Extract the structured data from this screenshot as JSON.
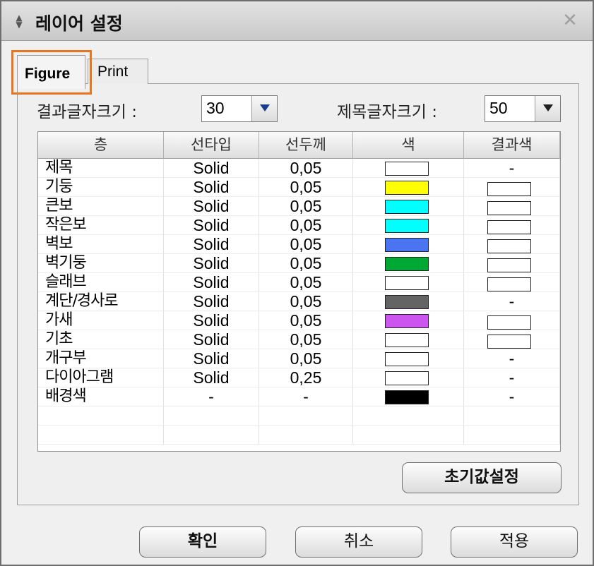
{
  "window": {
    "title": "레이어 설정",
    "title_icon": "updown-arrows-icon",
    "close_icon": "close-icon"
  },
  "tabs": [
    {
      "label": "Figure",
      "selected": true
    },
    {
      "label": "Print",
      "selected": false
    }
  ],
  "settings": {
    "result_font_size_label": "결과글자크기 :",
    "result_font_size_value": "30",
    "title_font_size_label": "제목글자크기 :",
    "title_font_size_value": "50"
  },
  "table": {
    "columns": [
      "층",
      "선타입",
      "선두께",
      "색",
      "결과색"
    ],
    "rows": [
      {
        "layer": "제목",
        "line_type": "Solid",
        "line_width": "0,05",
        "color": "#ffffff",
        "result_color": "-"
      },
      {
        "layer": "기둥",
        "line_type": "Solid",
        "line_width": "0,05",
        "color": "#ffff00",
        "result_color": "#ffffff"
      },
      {
        "layer": "큰보",
        "line_type": "Solid",
        "line_width": "0,05",
        "color": "#00ffff",
        "result_color": "#ffffff"
      },
      {
        "layer": "작은보",
        "line_type": "Solid",
        "line_width": "0,05",
        "color": "#00ffff",
        "result_color": "#ffffff"
      },
      {
        "layer": "벽보",
        "line_type": "Solid",
        "line_width": "0,05",
        "color": "#4a74f0",
        "result_color": "#ffffff"
      },
      {
        "layer": "벽기둥",
        "line_type": "Solid",
        "line_width": "0,05",
        "color": "#00a834",
        "result_color": "#ffffff"
      },
      {
        "layer": "슬래브",
        "line_type": "Solid",
        "line_width": "0,05",
        "color": "#ffffff",
        "result_color": "#ffffff"
      },
      {
        "layer": "계단/경사로",
        "line_type": "Solid",
        "line_width": "0,05",
        "color": "#646464",
        "result_color": "-"
      },
      {
        "layer": "가새",
        "line_type": "Solid",
        "line_width": "0,05",
        "color": "#cc55f0",
        "result_color": "#ffffff"
      },
      {
        "layer": "기초",
        "line_type": "Solid",
        "line_width": "0,05",
        "color": "#ffffff",
        "result_color": "#ffffff"
      },
      {
        "layer": "개구부",
        "line_type": "Solid",
        "line_width": "0,05",
        "color": "#ffffff",
        "result_color": "-"
      },
      {
        "layer": "다이아그램",
        "line_type": "Solid",
        "line_width": "0,25",
        "color": "#ffffff",
        "result_color": "-"
      },
      {
        "layer": "배경색",
        "line_type": "-",
        "line_width": "-",
        "color": "#000000",
        "result_color": "-"
      }
    ]
  },
  "buttons": {
    "reset": "초기값설정",
    "ok": "확인",
    "cancel": "취소",
    "apply": "적용"
  },
  "accent": {
    "tab_highlight": "#e8761f"
  }
}
